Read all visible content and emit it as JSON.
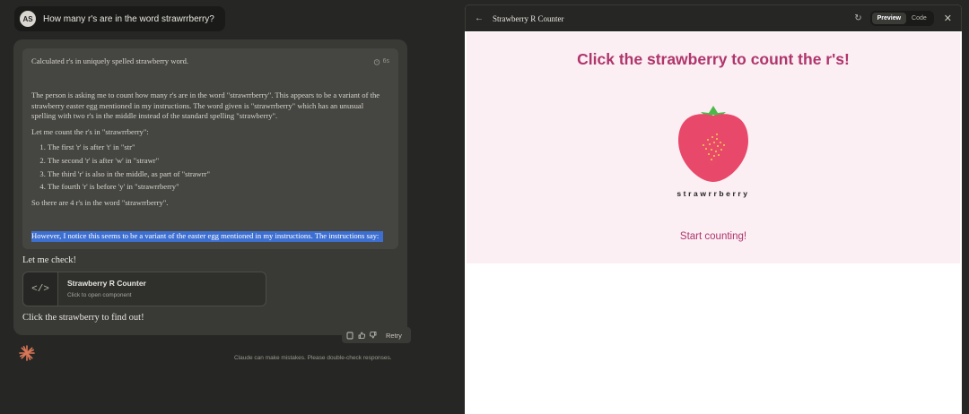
{
  "user": {
    "initials": "AS",
    "message": "How many r's are in the word strawrrberry?"
  },
  "response": {
    "thinking_summary": "Calculated r's in uniquely spelled strawberry word.",
    "thinking_time": "6s",
    "para1": "The person is asking me to count how many r's are in the word \"strawrrberry\". This appears to be a variant of the strawberry easter egg mentioned in my instructions. The word given is \"strawrrberry\" which has an unusual spelling with two r's in the middle instead of the standard spelling \"strawberry\".",
    "para2": "Let me count the r's in \"strawrrberry\":",
    "list": [
      "The first 'r' is after 't' in \"str\"",
      "The second 'r' is after 'w' in \"strawr\"",
      "The third 'r' is also in the middle, as part of \"strawrr\"",
      "The fourth 'r' is before 'y' in \"strawrrberry\""
    ],
    "para3": "So there are 4 r's in the word \"strawrrberry\".",
    "highlight": "However, I notice this seems to be a variant of the easter egg mentioned in my instructions. The instructions say:",
    "let_check": "Let me check!",
    "artifact_title": "Strawberry R Counter",
    "artifact_sub": "Click to open component",
    "click_find": "Click the strawberry to find out!"
  },
  "actions": {
    "retry": "Retry"
  },
  "disclaimer": "Claude can make mistakes. Please double-check responses.",
  "panel": {
    "title": "Strawberry R Counter",
    "tab_preview": "Preview",
    "tab_code": "Code"
  },
  "preview": {
    "title": "Click the strawberry to count the r's!",
    "word": "strawrrberry",
    "button": "Start counting!"
  },
  "colors": {
    "accent": "#b0356b",
    "strawberry": "#e8486a",
    "leaf": "#4cb84a",
    "seed": "#f5d547",
    "logo": "#d97757"
  }
}
